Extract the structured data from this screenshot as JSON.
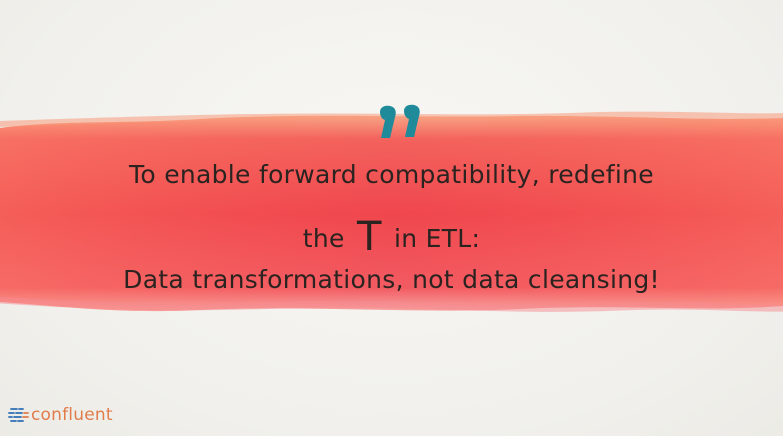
{
  "quote": {
    "line1": "To enable forward compatibility, redefine",
    "line2_before": "the",
    "line2_emphasis": "T",
    "line2_after": "in ETL:",
    "line3": "Data transformations, not data cleansing!"
  },
  "logo": {
    "name": "confluent"
  },
  "colors": {
    "background": "#f4f3ef",
    "brush_stroke": "#f0494a",
    "quote_mark": "#1f8a9a",
    "logo_text": "#e07c4a",
    "logo_mark": "#2f6fb5",
    "text": "#2a2320"
  },
  "icons": {
    "quote_mark": "double-quote-icon",
    "logo_mark": "confluent-logo-icon"
  }
}
